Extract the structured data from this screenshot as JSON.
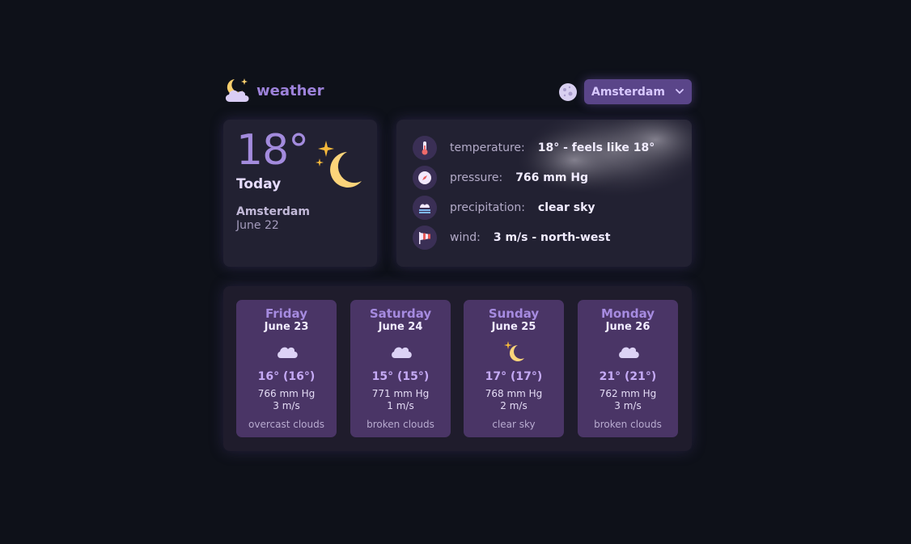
{
  "app": {
    "logo_text": "weather",
    "logo_icon": "moon-cloud-icon"
  },
  "header": {
    "theme_toggle_icon": "moon-icon",
    "city_select": {
      "value": "Amsterdam",
      "icon": "chevron-down-icon"
    }
  },
  "today": {
    "temperature": "18°",
    "label": "Today",
    "city": "Amsterdam",
    "date": "June 22",
    "icon": "crescent-moon-icon"
  },
  "details": [
    {
      "label": "temperature:",
      "value": "18° - feels like 18°",
      "icon": "thermometer-icon"
    },
    {
      "label": "pressure:",
      "value": "766 mm Hg",
      "icon": "compass-icon"
    },
    {
      "label": "precipitation:",
      "value": "clear sky",
      "icon": "precipitation-icon"
    },
    {
      "label": "wind:",
      "value": "3 m/s - north-west",
      "icon": "windsock-icon"
    }
  ],
  "forecast": [
    {
      "day": "Friday",
      "date": "June 23",
      "icon": "cloud-icon",
      "temp": "16° (16°)",
      "pressure": "766 mm Hg",
      "wind": "3 m/s",
      "desc": "overcast clouds"
    },
    {
      "day": "Saturday",
      "date": "June 24",
      "icon": "cloud-icon",
      "temp": "15° (15°)",
      "pressure": "771 mm Hg",
      "wind": "1 m/s",
      "desc": "broken clouds"
    },
    {
      "day": "Sunday",
      "date": "June 25",
      "icon": "crescent-moon-icon",
      "temp": "17° (17°)",
      "pressure": "768 mm Hg",
      "wind": "2 m/s",
      "desc": "clear sky"
    },
    {
      "day": "Monday",
      "date": "June 26",
      "icon": "cloud-icon",
      "temp": "21° (21°)",
      "pressure": "762 mm Hg",
      "wind": "3 m/s",
      "desc": "broken clouds"
    }
  ],
  "colors": {
    "background": "#0e1119",
    "accent": "#9d82da",
    "card": "#222132",
    "day_card": "#4a3566",
    "moon": "#fbd47a"
  }
}
